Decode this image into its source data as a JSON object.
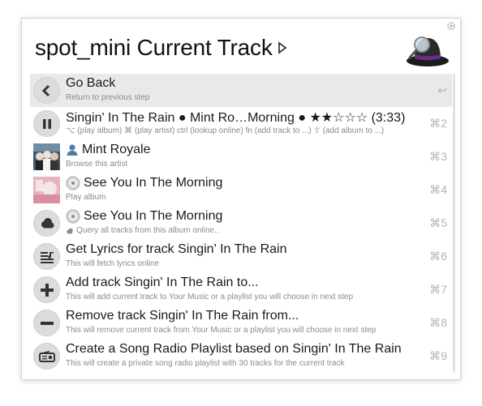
{
  "header": {
    "query": "spot_mini Current Track",
    "app_icon": "alfred-hat-icon"
  },
  "rows": [
    {
      "title": "Go Back",
      "subtitle": "Return to previous step",
      "shortcut": "↩",
      "icon": "back-arrow-icon"
    },
    {
      "title": "Singin' In The Rain ● Mint Ro…Morning ● ★★☆☆☆ (3:33)",
      "subtitle": "⌥ (play album) ⌘ (play artist) ctrl (lookup online) fn (add track to ...) ⇧ (add album to ...)",
      "shortcut": "⌘2",
      "icon": "pause-icon"
    },
    {
      "title": "Mint Royale",
      "subtitle": "Browse this artist",
      "shortcut": "⌘3",
      "icon": "artist-thumbnail"
    },
    {
      "title": "See You In The Morning",
      "subtitle": "Play album",
      "shortcut": "⌘4",
      "icon": "album-thumbnail"
    },
    {
      "title": "See You In The Morning",
      "subtitle": "Query all tracks from this album online..",
      "shortcut": "⌘5",
      "icon": "cloud-icon"
    },
    {
      "title": "Get Lyrics for track Singin' In The Rain",
      "subtitle": "This will fetch lyrics online",
      "shortcut": "⌘6",
      "icon": "lyrics-icon"
    },
    {
      "title": "Add track Singin' In The Rain to...",
      "subtitle": "This will add current track to Your Music or a playlist you will choose in next step",
      "shortcut": "⌘7",
      "icon": "plus-icon"
    },
    {
      "title": "Remove track Singin' In The Rain from...",
      "subtitle": "This will remove current track from Your Music or a playlist you will choose in next step",
      "shortcut": "⌘8",
      "icon": "minus-icon"
    },
    {
      "title": "Create a Song Radio Playlist based on Singin' In The Rain",
      "subtitle": "This will create a private song radio playlist with 30 tracks for the current track",
      "shortcut": "⌘9",
      "icon": "radio-icon"
    }
  ]
}
